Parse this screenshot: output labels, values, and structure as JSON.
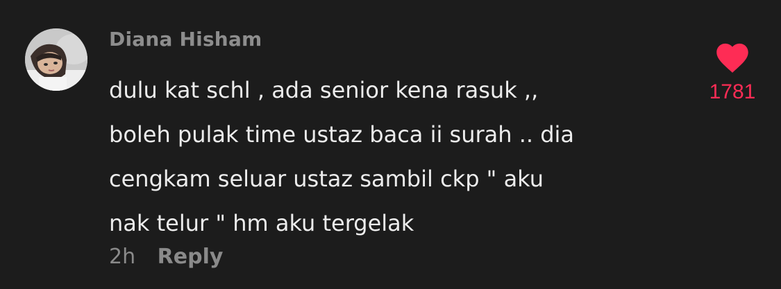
{
  "comment": {
    "username": "Diana Hisham",
    "text_lines": [
      "dulu kat schl , ada senior kena rasuk ,,",
      "boleh pulak time ustaz baca ii surah .. dia",
      "cengkam seluar ustaz sambil ckp \" aku",
      "nak telur \" hm aku tergelak"
    ],
    "time": "2h",
    "reply_label": "Reply",
    "likes": "1781",
    "like_icon": "heart-icon",
    "like_color": "#fe2c55"
  }
}
